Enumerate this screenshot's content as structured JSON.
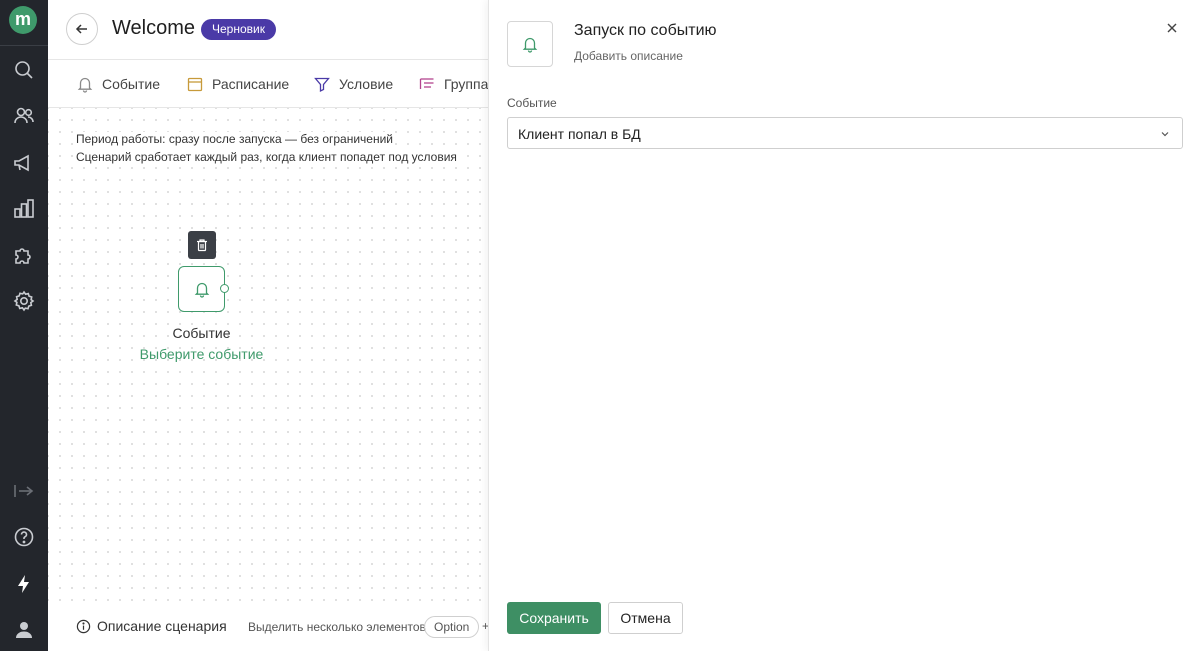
{
  "nav": {
    "logo_letter": "m",
    "items": [
      {
        "name": "search",
        "icon": "search-icon"
      },
      {
        "name": "clients",
        "icon": "users-icon"
      },
      {
        "name": "campaigns",
        "icon": "megaphone-icon"
      },
      {
        "name": "analytics",
        "icon": "chart-icon"
      },
      {
        "name": "integrations",
        "icon": "puzzle-icon"
      },
      {
        "name": "settings",
        "icon": "gear-icon"
      }
    ],
    "bottom_items": [
      {
        "name": "collapse",
        "icon": "collapse-arrow-icon"
      },
      {
        "name": "help",
        "icon": "help-icon"
      },
      {
        "name": "updates",
        "icon": "lightning-icon"
      },
      {
        "name": "profile",
        "icon": "user-icon"
      }
    ]
  },
  "header": {
    "title": "Welcome",
    "status_badge": "Черновик"
  },
  "tabs": [
    {
      "label": "Событие",
      "icon": "bell-icon"
    },
    {
      "label": "Расписание",
      "icon": "calendar-icon"
    },
    {
      "label": "Условие",
      "icon": "filter-icon"
    },
    {
      "label": "Группа",
      "icon": "group-icon"
    }
  ],
  "canvas": {
    "period_text": "Период работы: сразу после запуска — без ограничений",
    "trigger_text": "Сценарий сработает каждый раз, когда клиент попадет под условия",
    "node": {
      "title": "Событие",
      "subtitle": "Выберите событие",
      "icon": "bell-icon",
      "delete_icon": "trash-icon"
    }
  },
  "footer": {
    "description_link": "Описание сценария",
    "multi_select_hint": "Выделить несколько элементов",
    "key_label": "Option",
    "plus": "+"
  },
  "panel": {
    "title": "Запуск по событию",
    "add_description": "Добавить описание",
    "field_label": "Событие",
    "selected_event": "Клиент попал в БД",
    "save_label": "Сохранить",
    "cancel_label": "Отмена"
  },
  "colors": {
    "accent_green": "#3f9a6b",
    "badge_purple": "#4a3aa7",
    "nav_bg": "#23262c"
  }
}
